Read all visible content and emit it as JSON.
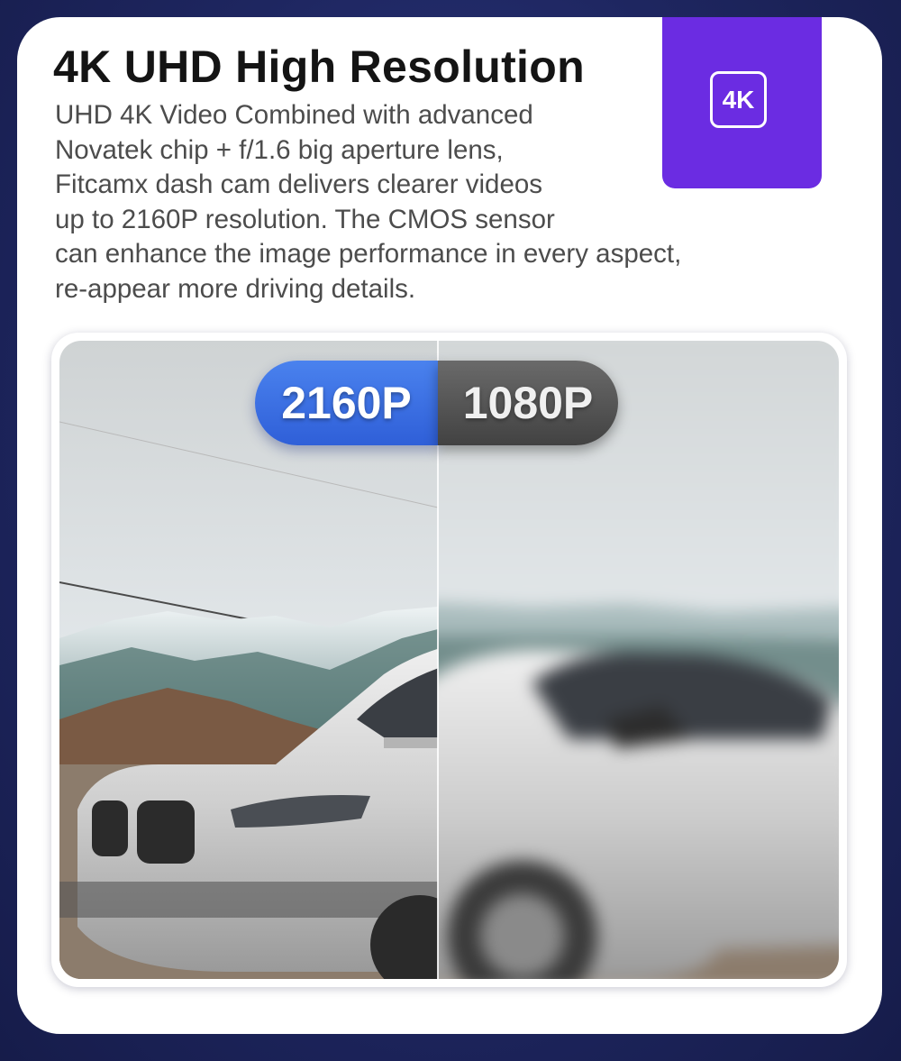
{
  "header": {
    "title": "4K UHD High Resolution",
    "description_lines": [
      "UHD 4K Video Combined with advanced",
      "Novatek chip + f/1.6 big aperture lens,",
      "Fitcamx dash cam delivers clearer videos",
      "up to 2160P resolution. The CMOS sensor",
      "can enhance the image performance in every aspect,",
      "re-appear more driving details."
    ]
  },
  "badge": {
    "label": "4K",
    "color": "#6b2ce2"
  },
  "comparison": {
    "left_label": "2160P",
    "right_label": "1080P",
    "left_color": "#3a6fe3",
    "right_color": "#555555"
  },
  "colors": {
    "background": "#1e2660",
    "card": "#ffffff",
    "title": "#141414",
    "body_text": "#4c4c4c"
  }
}
